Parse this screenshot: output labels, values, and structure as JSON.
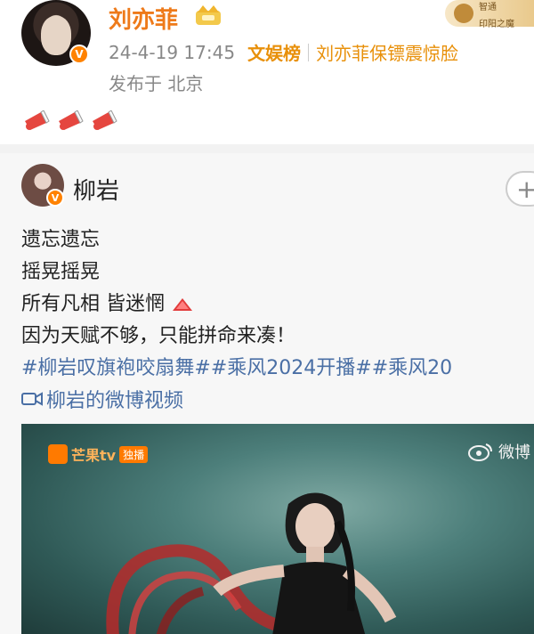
{
  "post": {
    "author": "刘亦菲",
    "datetime": "24-4-19 17:45",
    "source": "文娱榜",
    "topic": "刘亦菲保镖震惊脸",
    "location": "发布于 北京",
    "badge_text": [
      "智通",
      "印阳之魔"
    ],
    "icons": [
      "megaphone-icon",
      "megaphone-icon",
      "megaphone-icon"
    ]
  },
  "repost": {
    "author": "柳岩",
    "follow_label": "+",
    "lines": [
      "遗忘遗忘",
      "摇晃摇晃",
      "所有凡相 皆迷惘",
      "因为天赋不够，只能拼命来凑！"
    ],
    "tags": "#柳岩叹旗袍咬扇舞##乘风2024开播##乘风20",
    "video_link": "柳岩的微博视频"
  },
  "video": {
    "channel": "芒果tv",
    "channel_tag": "独播",
    "watermark": "微博"
  },
  "colors": {
    "accent_orange": "#ee7a1a",
    "link_blue": "#4a6fa5",
    "meta_gray": "#888888"
  }
}
